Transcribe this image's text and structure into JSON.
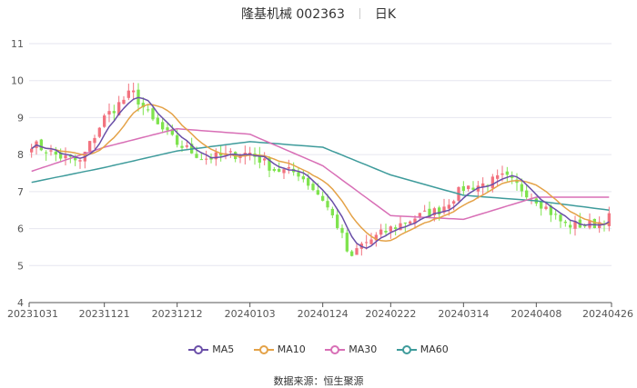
{
  "header": {
    "stock_name": "隆基机械 002363",
    "period": "日K"
  },
  "source_label": "数据来源：",
  "source_name": "恒生聚源",
  "colors": {
    "up": "#f2727f",
    "down": "#7fe34e",
    "ma5": "#6a4fa8",
    "ma10": "#e4a247",
    "ma30": "#d86fb6",
    "ma60": "#3e9b9b",
    "grid": "#e6e6ef"
  },
  "chart_data": {
    "type": "candlestick",
    "title": "隆基机械 002363 日K",
    "ylim": [
      4,
      11
    ],
    "yticks": [
      4,
      5,
      6,
      7,
      8,
      9,
      10,
      11
    ],
    "xlabels": [
      "20231031",
      "20231121",
      "20231212",
      "20240103",
      "20240124",
      "20240222",
      "20240314",
      "20240408",
      "20240426"
    ],
    "legend": [
      "MA5",
      "MA10",
      "MA30",
      "MA60"
    ],
    "legend_position": "bottom",
    "anchors": [
      {
        "x": "20231031",
        "close": 8.3
      },
      {
        "x": "20231108",
        "close": 7.95
      },
      {
        "x": "20231114",
        "close": 7.8
      },
      {
        "x": "20231121",
        "close": 9.0
      },
      {
        "x": "20231129",
        "close": 9.7
      },
      {
        "x": "20231205",
        "close": 8.9
      },
      {
        "x": "20231212",
        "close": 8.3
      },
      {
        "x": "20231220",
        "close": 7.9
      },
      {
        "x": "20240103",
        "close": 8.05
      },
      {
        "x": "20240110",
        "close": 7.6
      },
      {
        "x": "20240117",
        "close": 7.5
      },
      {
        "x": "20240124",
        "close": 6.8
      },
      {
        "x": "20240131",
        "close": 6.0
      },
      {
        "x": "20240205",
        "close": 5.1
      },
      {
        "x": "20240208",
        "close": 5.5
      },
      {
        "x": "20240222",
        "close": 6.0
      },
      {
        "x": "20240229",
        "close": 6.3
      },
      {
        "x": "20240307",
        "close": 6.5
      },
      {
        "x": "20240314",
        "close": 7.1
      },
      {
        "x": "20240321",
        "close": 7.2
      },
      {
        "x": "20240328",
        "close": 7.4
      },
      {
        "x": "20240408",
        "close": 6.8
      },
      {
        "x": "20240415",
        "close": 6.1
      },
      {
        "x": "20240422",
        "close": 6.1
      },
      {
        "x": "20240426",
        "close": 6.3
      }
    ],
    "ma30_anchors": [
      {
        "x": "20231031",
        "y": 7.55
      },
      {
        "x": "20231121",
        "y": 8.2
      },
      {
        "x": "20231212",
        "y": 8.7
      },
      {
        "x": "20240103",
        "y": 8.55
      },
      {
        "x": "20240124",
        "y": 7.7
      },
      {
        "x": "20240222",
        "y": 6.35
      },
      {
        "x": "20240314",
        "y": 6.25
      },
      {
        "x": "20240408",
        "y": 6.85
      },
      {
        "x": "20240426",
        "y": 6.85
      }
    ],
    "ma60_anchors": [
      {
        "x": "20231031",
        "y": 7.25
      },
      {
        "x": "20231121",
        "y": 7.65
      },
      {
        "x": "20231212",
        "y": 8.1
      },
      {
        "x": "20240103",
        "y": 8.35
      },
      {
        "x": "20240124",
        "y": 8.2
      },
      {
        "x": "20240222",
        "y": 7.45
      },
      {
        "x": "20240314",
        "y": 6.9
      },
      {
        "x": "20240408",
        "y": 6.75
      },
      {
        "x": "20240426",
        "y": 6.5
      }
    ]
  }
}
